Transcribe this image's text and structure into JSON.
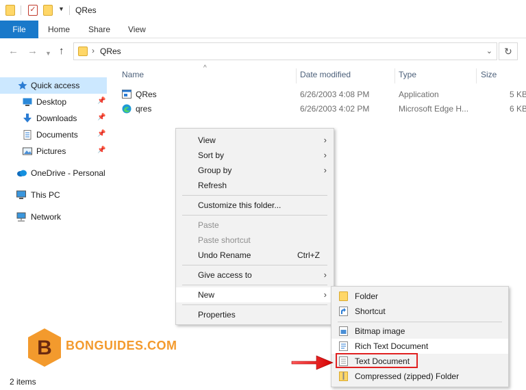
{
  "window": {
    "title": "QRes"
  },
  "ribbon": {
    "tabs": [
      "File",
      "Home",
      "Share",
      "View"
    ]
  },
  "address": {
    "path": "QRes"
  },
  "sidebar": {
    "items": [
      {
        "label": "Quick access",
        "icon": "star-icon"
      },
      {
        "label": "Desktop",
        "icon": "desktop-icon"
      },
      {
        "label": "Downloads",
        "icon": "download-icon"
      },
      {
        "label": "Documents",
        "icon": "documents-icon"
      },
      {
        "label": "Pictures",
        "icon": "pictures-icon"
      },
      {
        "label": "OneDrive - Personal",
        "icon": "cloud-icon"
      },
      {
        "label": "This PC",
        "icon": "computer-icon"
      },
      {
        "label": "Network",
        "icon": "network-icon"
      }
    ]
  },
  "filelist": {
    "columns": [
      "Name",
      "Date modified",
      "Type",
      "Size"
    ],
    "rows": [
      {
        "name": "QRes",
        "date": "6/26/2003 4:08 PM",
        "type": "Application",
        "size": "5 KB"
      },
      {
        "name": "qres",
        "date": "6/26/2003 4:02 PM",
        "type": "Microsoft Edge H...",
        "size": "6 KB"
      }
    ]
  },
  "context_menu": {
    "view": "View",
    "sort_by": "Sort by",
    "group_by": "Group by",
    "refresh": "Refresh",
    "customize": "Customize this folder...",
    "paste": "Paste",
    "paste_shortcut": "Paste shortcut",
    "undo_rename": "Undo Rename",
    "undo_shortcut": "Ctrl+Z",
    "give_access": "Give access to",
    "new": "New",
    "properties": "Properties"
  },
  "new_submenu": {
    "folder": "Folder",
    "shortcut": "Shortcut",
    "bitmap": "Bitmap image",
    "rtf": "Rich Text Document",
    "text": "Text Document",
    "zip": "Compressed (zipped) Folder"
  },
  "watermark": {
    "letter": "B",
    "text": "BONGUIDES.COM"
  },
  "status": {
    "items": "2 items"
  },
  "colors": {
    "accent": "#1979ca",
    "selection": "#cce8ff",
    "highlight": "#e02020",
    "brand": "#f39a2d"
  }
}
